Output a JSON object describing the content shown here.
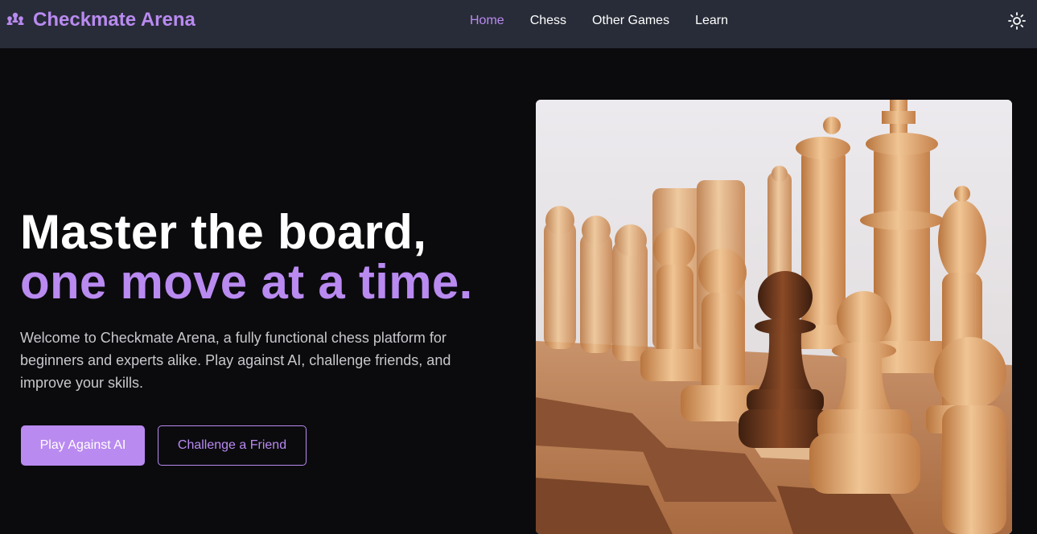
{
  "brand": {
    "name": "Checkmate Arena",
    "icon": "chess-pieces-icon"
  },
  "nav": {
    "items": [
      {
        "label": "Home",
        "active": true
      },
      {
        "label": "Chess",
        "active": false
      },
      {
        "label": "Other Games",
        "active": false
      },
      {
        "label": "Learn",
        "active": false
      }
    ],
    "theme_toggle_icon": "sun-icon"
  },
  "hero": {
    "title_line1": "Master the board,",
    "title_line2": "one move at a time.",
    "description": "Welcome to Checkmate Arena, a fully functional chess platform for beginners and experts alike. Play against AI, challenge friends, and improve your skills.",
    "primary_button": "Play Against AI",
    "secondary_button": "Challenge a Friend",
    "image_alt": "wooden chess pieces on a board"
  },
  "colors": {
    "accent": "#b98af0",
    "navbar_bg": "#282c38",
    "page_bg": "#0b0b0e",
    "text": "#ffffff",
    "muted_text": "#c8c8cc"
  }
}
